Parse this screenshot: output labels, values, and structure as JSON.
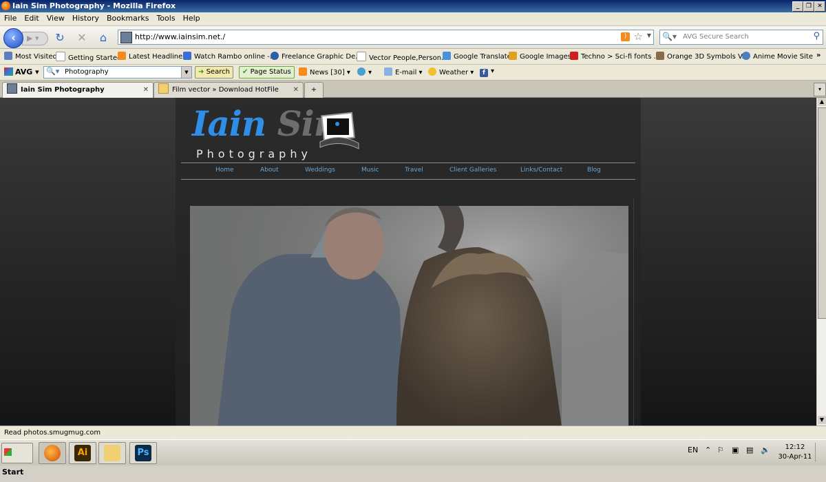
{
  "window": {
    "title": "Iain Sim Photography - Mozilla Firefox"
  },
  "menu": [
    "File",
    "Edit",
    "View",
    "History",
    "Bookmarks",
    "Tools",
    "Help"
  ],
  "address": {
    "url": "http://www.iainsim.net./"
  },
  "search": {
    "placeholder": "AVG Secure Search"
  },
  "bookmarks": [
    {
      "label": "Most Visited",
      "color": "#5b7fc0"
    },
    {
      "label": "Getting Started",
      "color": "#ffffff"
    },
    {
      "label": "Latest Headlines",
      "color": "#f58a1f"
    },
    {
      "label": "Watch Rambo online -...",
      "color": "#3a6fd8"
    },
    {
      "label": "Freelance Graphic De...",
      "color": "#2a5ea8"
    },
    {
      "label": "Vector People,Person...",
      "color": "#ffffff"
    },
    {
      "label": "Google Translate",
      "color": "#4a8fe0"
    },
    {
      "label": "Google Images",
      "color": "#e0a020"
    },
    {
      "label": "Techno > Sci-fi fonts ...",
      "color": "#cc2020"
    },
    {
      "label": "Orange 3D Symbols V...",
      "color": "#8a6a4a"
    },
    {
      "label": "Anime Movie Site",
      "color": "#4a80c0"
    }
  ],
  "avg": {
    "logo": "AVG",
    "search_value": "Photography",
    "search_button": "Search",
    "page_status": "Page Status",
    "news": "News [30]",
    "email": "E-mail",
    "weather": "Weather"
  },
  "tabs": [
    {
      "label": "Iain Sim Photography",
      "active": true
    },
    {
      "label": "Film vector » Download HotFile Fileserv...",
      "active": false
    }
  ],
  "site": {
    "logo_initial": "Iain",
    "logo_surname": "Sim",
    "logo_sub": "Photography",
    "nav": [
      "Home",
      "About",
      "Weddings",
      "Music",
      "Travel",
      "Client Galleries",
      "Links/Contact",
      "Blog"
    ],
    "nav_color": "#67a6d6"
  },
  "status": {
    "text": "Read photos.smugmug.com"
  },
  "taskbar": {
    "start": "Start",
    "apps": [
      "firefox",
      "Ai",
      "folder",
      "Ps"
    ],
    "lang": "EN",
    "time": "12:12",
    "date": "30-Apr-11"
  }
}
